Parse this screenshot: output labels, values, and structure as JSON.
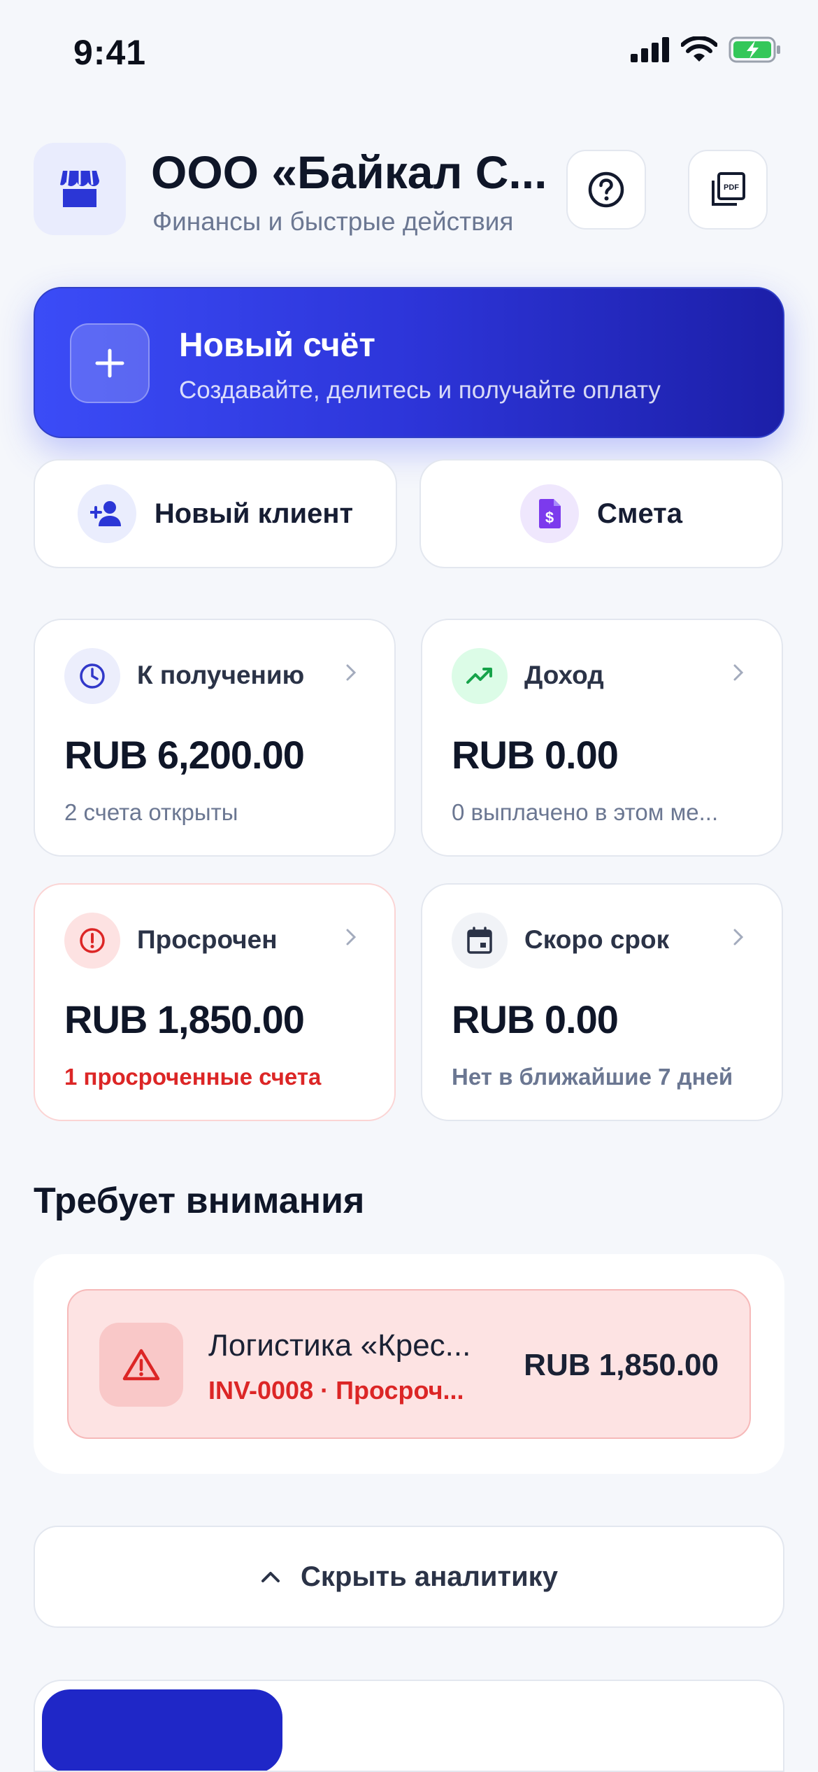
{
  "status": {
    "time": "9:41"
  },
  "header": {
    "company": "ООО «Байкал С...",
    "subtitle": "Финансы и быстрые действия",
    "icons": {
      "logo": "storefront-icon",
      "help": "help-circle-icon",
      "pdf": "pdf-icon"
    }
  },
  "hero": {
    "title": "Новый счёт",
    "subtitle": "Создавайте, делитесь и получайте оплату",
    "icon": "plus-icon"
  },
  "quick_actions": [
    {
      "label": "Новый клиент",
      "icon": "add-user-icon",
      "color": "#2b36d6",
      "bg": "#eaedfd"
    },
    {
      "label": "Смета",
      "icon": "invoice-dollar-icon",
      "color": "#7c3aed",
      "bg": "#efe7fd"
    }
  ],
  "stats": [
    {
      "label": "К получению",
      "value": "RUB 6,200.00",
      "note": "2 счета открыты",
      "icon": "clock-icon",
      "color": "#3138c9",
      "bg": "#eceefc"
    },
    {
      "label": "Доход",
      "value": "RUB 0.00",
      "note": "0 выплачено в этом ме...",
      "icon": "trending-up-icon",
      "color": "#16a34a",
      "bg": "#dcfce7"
    },
    {
      "label": "Просрочен",
      "value": "RUB 1,850.00",
      "note": "1 просроченные счета",
      "icon": "alert-circle-icon",
      "color": "#dc2626",
      "bg": "#fde2e2"
    },
    {
      "label": "Скоро срок",
      "value": "RUB 0.00",
      "note": "Нет в ближайшие 7 дней",
      "icon": "calendar-icon",
      "color": "#2b3347",
      "bg": "#f1f3f7"
    }
  ],
  "attention": {
    "title": "Требует внимания",
    "items": [
      {
        "client": "Логистика «Крес...",
        "meta": "INV-0008 · Просроч...",
        "amount": "RUB 1,850.00",
        "icon": "warning-triangle-icon"
      }
    ]
  },
  "analytics_toggle": {
    "label": "Скрыть аналитику",
    "icon": "chevron-up-icon"
  },
  "colors": {
    "accent": "#3b4cf7",
    "danger": "#dc2626",
    "success": "#16a34a"
  }
}
